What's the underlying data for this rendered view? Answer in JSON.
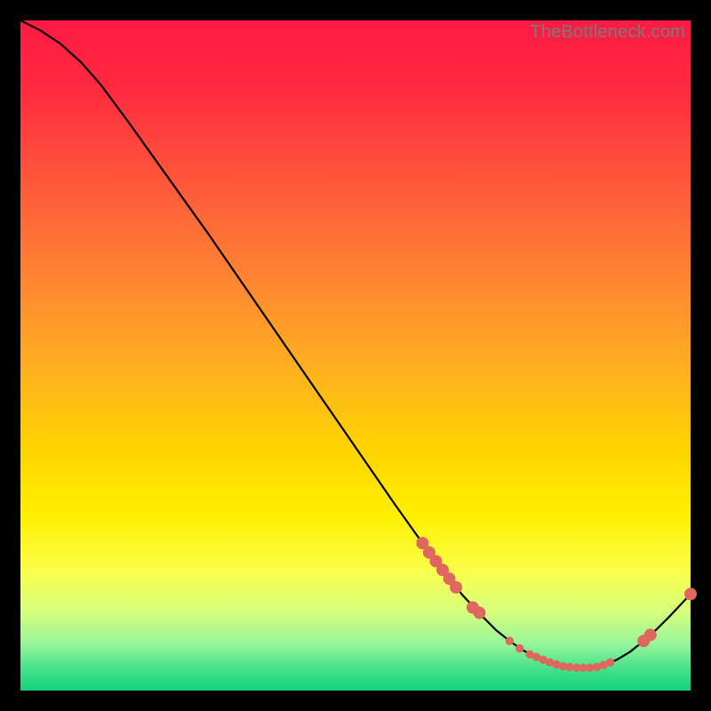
{
  "watermark": "TheBottleneck.com",
  "chart_data": {
    "type": "line",
    "title": "",
    "xlabel": "",
    "ylabel": "",
    "xlim": [
      0,
      100
    ],
    "ylim": [
      0,
      100
    ],
    "series": [
      {
        "name": "curve",
        "x": [
          0,
          3,
          6,
          9,
          12,
          16,
          20,
          24,
          28,
          32,
          36,
          40,
          44,
          48,
          52,
          56,
          60,
          63,
          66,
          69,
          71,
          73,
          75,
          77,
          79,
          81,
          83,
          85,
          87,
          89,
          91,
          93,
          95,
          97,
          100
        ],
        "y": [
          100,
          98.5,
          96.5,
          93.8,
          90.4,
          85.0,
          79.4,
          73.8,
          68.2,
          62.4,
          56.6,
          50.8,
          45.0,
          39.2,
          33.4,
          27.6,
          22.0,
          18.0,
          14.2,
          11.0,
          9.0,
          7.4,
          6.0,
          5.0,
          4.2,
          3.6,
          3.4,
          3.4,
          3.8,
          4.6,
          5.8,
          7.4,
          9.2,
          11.2,
          14.4
        ]
      }
    ],
    "markers_big": [
      {
        "x": 60,
        "y": 22.0
      },
      {
        "x": 61,
        "y": 20.6
      },
      {
        "x": 62,
        "y": 19.3
      },
      {
        "x": 63,
        "y": 18.0
      },
      {
        "x": 64,
        "y": 16.7
      },
      {
        "x": 65,
        "y": 15.4
      },
      {
        "x": 67.5,
        "y": 12.4
      },
      {
        "x": 68.5,
        "y": 11.6
      },
      {
        "x": 93,
        "y": 7.4
      },
      {
        "x": 94,
        "y": 8.3
      },
      {
        "x": 100,
        "y": 14.4
      }
    ],
    "markers_small": [
      {
        "x": 73,
        "y": 7.4
      },
      {
        "x": 74.5,
        "y": 6.3
      },
      {
        "x": 76,
        "y": 5.4
      },
      {
        "x": 77,
        "y": 5.0
      },
      {
        "x": 78,
        "y": 4.6
      },
      {
        "x": 79,
        "y": 4.2
      },
      {
        "x": 80,
        "y": 3.9
      },
      {
        "x": 81,
        "y": 3.6
      },
      {
        "x": 82,
        "y": 3.5
      },
      {
        "x": 83,
        "y": 3.4
      },
      {
        "x": 84,
        "y": 3.4
      },
      {
        "x": 85,
        "y": 3.4
      },
      {
        "x": 86,
        "y": 3.5
      },
      {
        "x": 87,
        "y": 3.8
      },
      {
        "x": 88,
        "y": 4.2
      }
    ]
  }
}
